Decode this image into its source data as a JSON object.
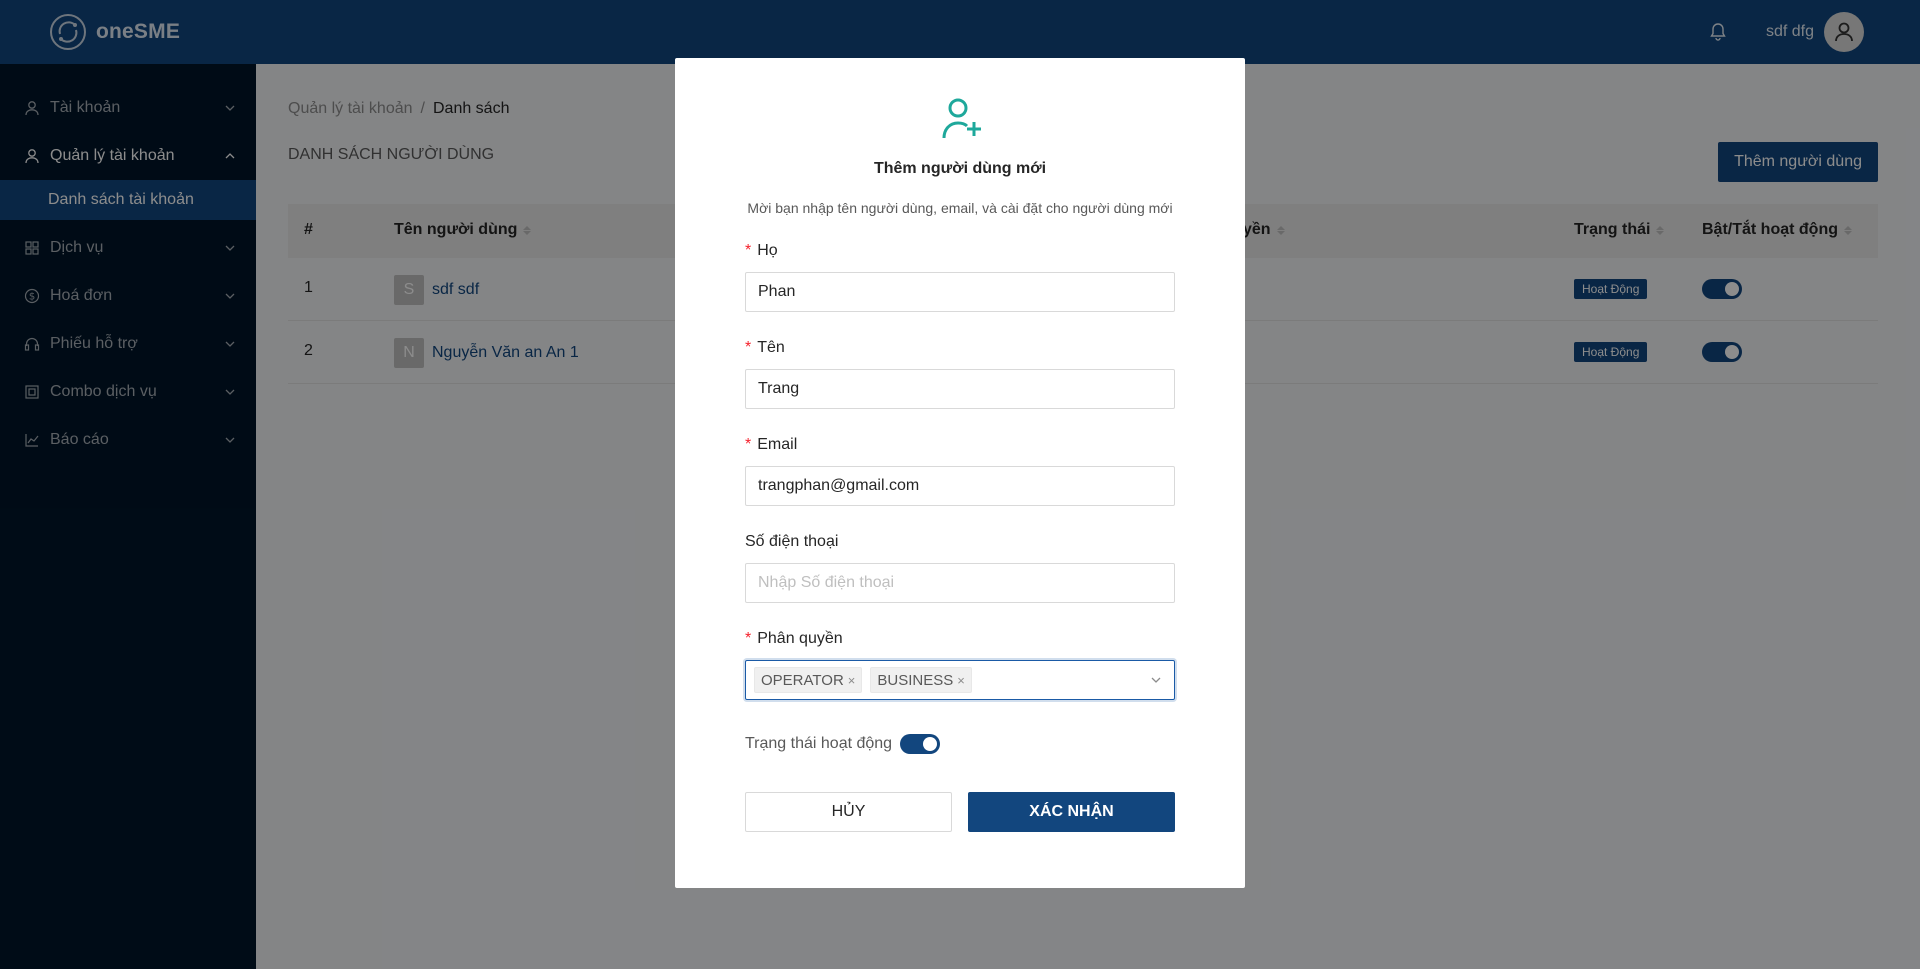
{
  "header": {
    "app_name": "oneSME",
    "username": "sdf dfg"
  },
  "sidebar": {
    "items": [
      {
        "label": "Tài khoản",
        "icon": "user-icon"
      },
      {
        "label": "Quản lý tài khoản",
        "icon": "user-icon"
      },
      {
        "label": "Danh sách tài khoản",
        "icon": ""
      },
      {
        "label": "Dịch vụ",
        "icon": "grid-icon"
      },
      {
        "label": "Hoá đơn",
        "icon": "dollar-icon"
      },
      {
        "label": "Phiếu hỗ trợ",
        "icon": "headset-icon"
      },
      {
        "label": "Combo dịch vụ",
        "icon": "combo-icon"
      },
      {
        "label": "Báo cáo",
        "icon": "chart-icon"
      }
    ]
  },
  "breadcrumb": {
    "parent": "Quản lý tài khoản",
    "separator": "/",
    "current": "Danh sách"
  },
  "page": {
    "title": "DANH SÁCH NGƯỜI DÙNG",
    "add_button": "Thêm người dùng"
  },
  "table": {
    "columns": [
      "#",
      "Tên người dùng",
      "yền",
      "Trạng thái",
      "Bật/Tắt hoạt động"
    ],
    "rows": [
      {
        "index": "1",
        "initial": "S",
        "name": "sdf sdf",
        "status": "Hoạt Động",
        "active": true
      },
      {
        "index": "2",
        "initial": "N",
        "name": "Nguyễn Văn an An 1",
        "status": "Hoạt Động",
        "active": true
      }
    ]
  },
  "modal": {
    "title": "Thêm người dùng mới",
    "description": "Mời bạn nhập tên người dùng, email, và cài đặt cho người dùng mới",
    "fields": {
      "last_name": {
        "label": "Họ",
        "value": "Phan",
        "required": true
      },
      "first_name": {
        "label": "Tên",
        "value": "Trang",
        "required": true
      },
      "email": {
        "label": "Email",
        "value": "trangphan@gmail.com",
        "required": true
      },
      "phone": {
        "label": "Số điện thoại",
        "value": "",
        "placeholder": "Nhập Số điện thoại",
        "required": false
      },
      "role": {
        "label": "Phân quyền",
        "tags": [
          "OPERATOR",
          "BUSINESS"
        ],
        "required": true
      }
    },
    "status_label": "Trạng thái hoạt động",
    "status_on": true,
    "required_mark": "*",
    "tag_remove": "×",
    "cancel_label": "HỦY",
    "confirm_label": "XÁC NHẬN"
  },
  "colors": {
    "primary": "#12467e",
    "sidebar": "#001529",
    "accent_icon": "#1ea89b",
    "required": "#f5222d"
  }
}
